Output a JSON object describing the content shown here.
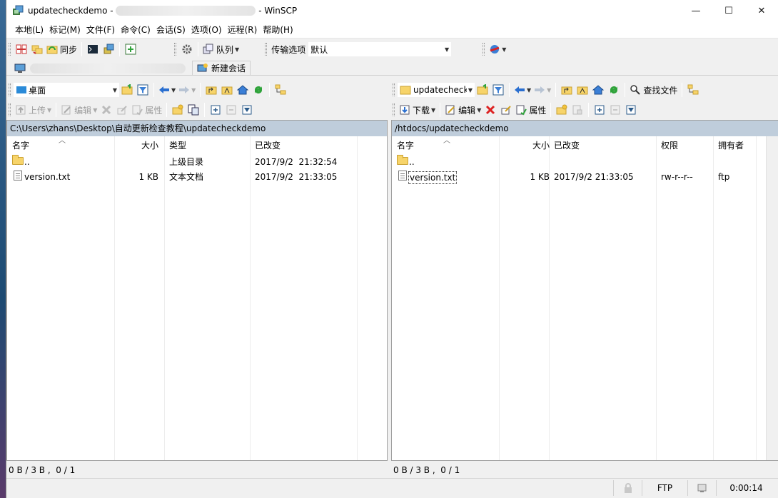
{
  "window": {
    "title_prefix": "updatecheckdemo - ",
    "title_suffix": " - WinSCP",
    "minimize": "—",
    "maximize": "☐",
    "close": "✕"
  },
  "menu": [
    "本地(L)",
    "标记(M)",
    "文件(F)",
    "命令(C)",
    "会话(S)",
    "选项(O)",
    "远程(R)",
    "帮助(H)"
  ],
  "toolbar": {
    "sync_label": "同步",
    "queue_label": "队列",
    "transfer_options_label": "传输选项",
    "transfer_preset": "默认"
  },
  "tabs": {
    "new_session": "新建会话"
  },
  "left": {
    "location": "桌面",
    "upload": "上传",
    "edit": "编辑",
    "properties": "属性",
    "path": "C:\\Users\\zhans\\Desktop\\自动更新检查教程\\updatecheckdemo",
    "columns": {
      "name": "名字",
      "size": "大小",
      "type": "类型",
      "changed": "已改变"
    },
    "rows": [
      {
        "name": "..",
        "size": "",
        "type": "上级目录",
        "changed": "2017/9/2  21:32:54",
        "kind": "folder"
      },
      {
        "name": "version.txt",
        "size": "1 KB",
        "type": "文本文档",
        "changed": "2017/9/2  21:33:05",
        "kind": "file"
      }
    ],
    "status": "0 B / 3 B ,  0 / 1"
  },
  "right": {
    "location": "updatecheckd",
    "download": "下载",
    "edit": "编辑",
    "properties": "属性",
    "find_files": "查找文件",
    "path": "/htdocs/updatecheckdemo",
    "columns": {
      "name": "名字",
      "size": "大小",
      "changed": "已改变",
      "rights": "权限",
      "owner": "拥有者"
    },
    "rows": [
      {
        "name": "..",
        "size": "",
        "changed": "",
        "rights": "",
        "owner": "",
        "kind": "folder"
      },
      {
        "name": "version.txt",
        "size": "1 KB",
        "changed": "2017/9/2 21:33:05",
        "rights": "rw-r--r--",
        "owner": "ftp",
        "kind": "file"
      }
    ],
    "status": "0 B / 3 B ,  0 / 1"
  },
  "statusbar": {
    "protocol": "FTP",
    "elapsed": "0:00:14"
  },
  "colors": {
    "path_bar": "#bfcddb",
    "folder": "#f7d46a",
    "back_arrow": "#2a6fd0",
    "refresh": "#2fa33a"
  }
}
